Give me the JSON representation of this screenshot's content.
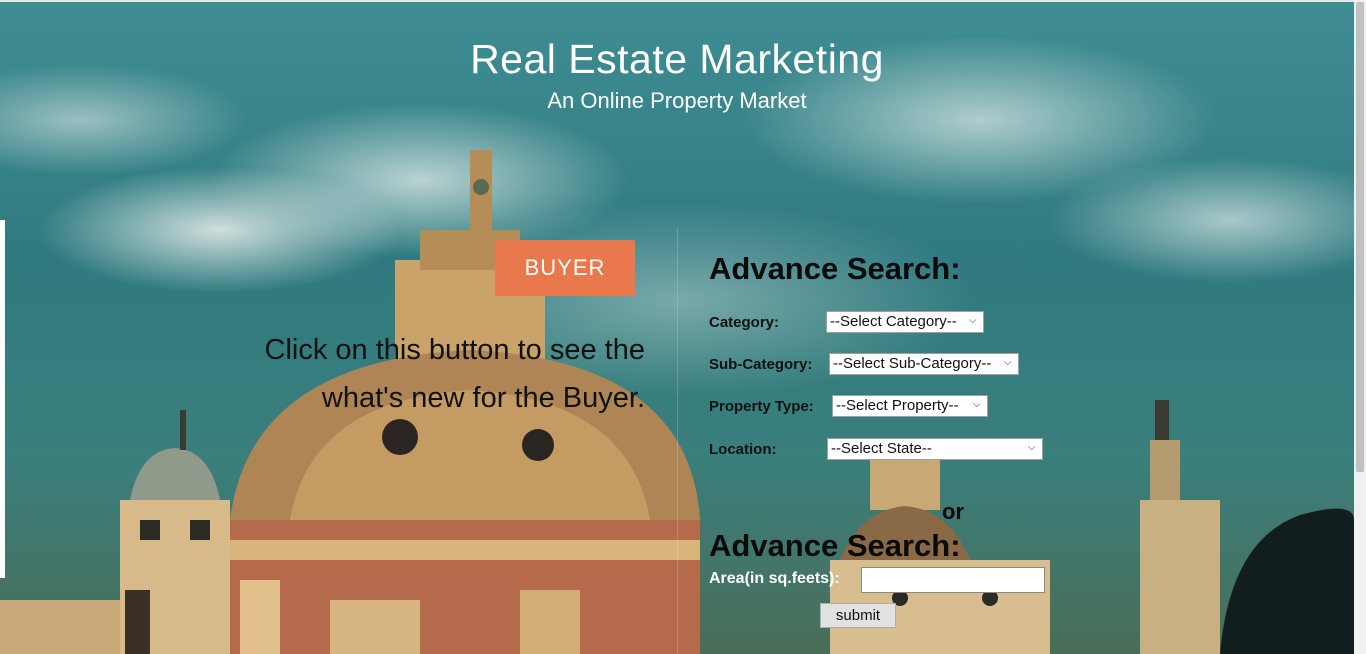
{
  "header": {
    "title": "Real Estate Marketing",
    "subtitle": "An Online Property Market"
  },
  "buyer": {
    "button_label": "BUYER",
    "description": "Click on this button to see the what's new for the Buyer."
  },
  "search": {
    "heading": "Advance Search:",
    "fields": [
      {
        "label": "Category:",
        "value": "--Select Category--"
      },
      {
        "label": "Sub-Category:",
        "value": "--Select Sub-Category--"
      },
      {
        "label": "Property Type:",
        "value": "--Select Property--"
      },
      {
        "label": "Location:",
        "value": "--Select State--"
      }
    ],
    "or_label": "or",
    "area_heading": "Advance Search:",
    "area_label": "Area(in sq.feets):",
    "area_value": "",
    "submit_label": "submit"
  },
  "colors": {
    "buyer_button": "#e9784c",
    "heading_text": "#0a0a0a",
    "header_text": "#ffffff"
  },
  "icons": [
    "chevron-down-icon"
  ]
}
